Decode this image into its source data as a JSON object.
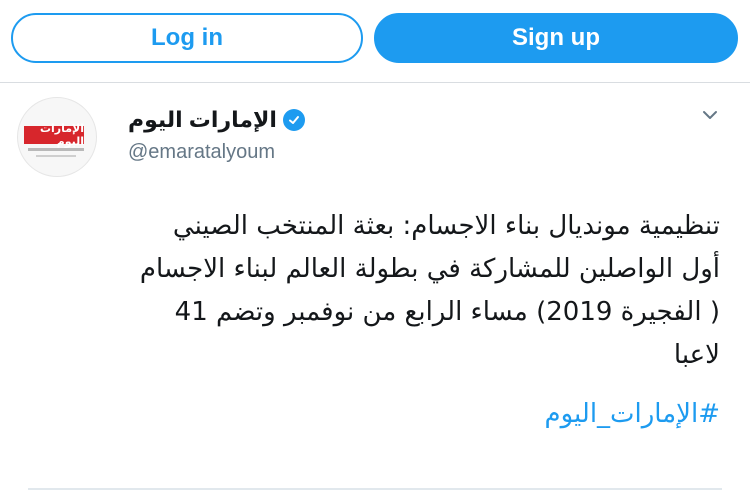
{
  "auth": {
    "login_label": "Log in",
    "signup_label": "Sign up"
  },
  "tweet": {
    "account_name": "الإمارات اليوم",
    "handle": "@emaratalyoum",
    "avatar_text": "الإمارات اليوم",
    "icons": {
      "verified": "verified-badge-icon",
      "menu": "chevron-down-icon"
    },
    "text_lines": [
      "تنظيمية مونديال بناء الاجسام: بعثة المنتخب الصيني",
      "أول الواصلين للمشاركة في بطولة العالم لبناء الاجسام",
      "( الفجيرة 2019)  مساء الرابع من نوفمبر  وتضم 41",
      "لاعبا"
    ],
    "hashtag": "#الإمارات_اليوم"
  },
  "colors": {
    "accent": "#1d9bf0",
    "text": "#14171a",
    "secondary_text": "#657786",
    "logo_red": "#d7262c"
  }
}
